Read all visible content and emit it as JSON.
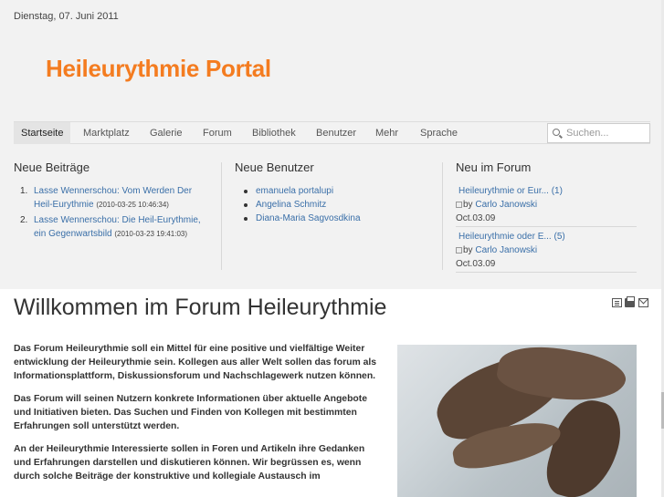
{
  "header": {
    "date": "Dienstag, 07. Juni 2011",
    "logo": "Heileurythmie Portal"
  },
  "nav": {
    "items": [
      "Startseite",
      "Marktplatz",
      "Galerie",
      "Forum",
      "Bibliothek",
      "Benutzer",
      "Mehr",
      "Sprache"
    ],
    "active": "Startseite",
    "search_placeholder": "Suchen..."
  },
  "new_posts": {
    "title": "Neue Beiträge",
    "items": [
      {
        "num": "1.",
        "link": "Lasse Wennerschou: Vom Werden Der Heil-Eurythmie",
        "timestamp": "(2010-03-25 10:46:34)"
      },
      {
        "num": "2.",
        "link": "Lasse Wennerschou: Die Heil-Eurythmie, ein Gegenwartsbild",
        "timestamp": "(2010-03-23 19:41:03)"
      }
    ]
  },
  "new_users": {
    "title": "Neue Benutzer",
    "items": [
      "emanuela portalupi",
      "Angelina Schmitz",
      "Diana-Maria Sagvosdkina"
    ]
  },
  "forum_new": {
    "title": "Neu im Forum",
    "items": [
      {
        "title": "Heileurythmie or Eur... (1)",
        "by": "by",
        "author": "Carlo Janowski",
        "date": "Oct.03.09"
      },
      {
        "title": "Heileurythmie oder E... (5)",
        "by": "by",
        "author": "Carlo Janowski",
        "date": "Oct.03.09"
      }
    ]
  },
  "main": {
    "title": "Willkommen im Forum Heileurythmie",
    "paragraphs": [
      "Das Forum Heileurythmie soll ein Mittel für eine positive und vielfältige Weiter entwicklung der Heileurythmie sein. Kollegen aus aller Welt sollen das forum als Informationsplattform, Diskussionsforum und Nachschlagewerk nutzen können.",
      "Das Forum will seinen Nutzern konkrete Informationen über aktuelle Angebote und Initiativen bieten. Das Suchen und Finden von Kollegen mit bestimmten Erfahrungen soll unterstützt werden.",
      "An der Heileurythmie Interessierte sollen in Foren und Artikeln ihre Gedanken und Erfahrungen darstellen und diskutieren können. Wir begrüssen es, wenn durch solche Beiträge der konstruktive und kollegiale Austausch im"
    ]
  },
  "colors": {
    "logo": "#f47c20",
    "link": "#3a6fa8",
    "header_bg": "#f2f2f2"
  }
}
